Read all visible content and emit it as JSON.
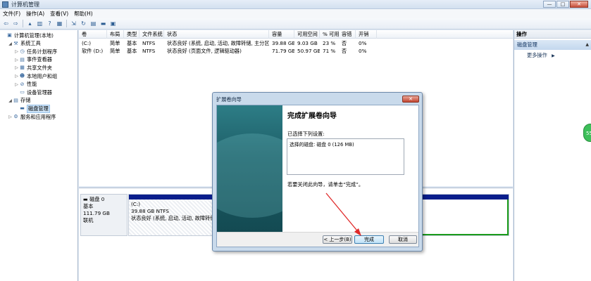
{
  "window": {
    "title": "计算机管理",
    "min": "—",
    "max": "□",
    "close": "✕"
  },
  "menu": [
    "文件(F)",
    "操作(A)",
    "查看(V)",
    "帮助(H)"
  ],
  "toolbar_icons": [
    "back-arrow-icon",
    "forward-arrow-icon",
    "up-folder-icon",
    "show-hide-tree-icon",
    "help-icon",
    "properties-icon",
    "export-icon",
    "refresh-icon",
    "view-icon",
    "disk-icon",
    "help-topics-icon"
  ],
  "tree": [
    {
      "label": "计算机管理(本地)",
      "level": 0,
      "exp": "",
      "icon": "computer-management-icon",
      "glyph": "▣"
    },
    {
      "label": "系统工具",
      "level": 1,
      "exp": "◢",
      "icon": "tools-icon",
      "glyph": "⚒"
    },
    {
      "label": "任务计划程序",
      "level": 2,
      "exp": "▷",
      "icon": "task-scheduler-icon",
      "glyph": "◷"
    },
    {
      "label": "事件查看器",
      "level": 2,
      "exp": "▷",
      "icon": "event-viewer-icon",
      "glyph": "▤"
    },
    {
      "label": "共享文件夹",
      "level": 2,
      "exp": "▷",
      "icon": "shared-folder-icon",
      "glyph": "▦"
    },
    {
      "label": "本地用户和组",
      "level": 2,
      "exp": "▷",
      "icon": "users-icon",
      "glyph": "☻"
    },
    {
      "label": "性能",
      "level": 2,
      "exp": "▷",
      "icon": "performance-icon",
      "glyph": "⊘"
    },
    {
      "label": "设备管理器",
      "level": 2,
      "exp": "",
      "icon": "device-manager-icon",
      "glyph": "▭"
    },
    {
      "label": "存储",
      "level": 1,
      "exp": "◢",
      "icon": "storage-icon",
      "glyph": "▤"
    },
    {
      "label": "磁盘管理",
      "level": 2,
      "exp": "",
      "icon": "disk-management-icon",
      "glyph": "▬"
    },
    {
      "label": "服务和应用程序",
      "level": 1,
      "exp": "▷",
      "icon": "services-icon",
      "glyph": "⚙"
    }
  ],
  "columns": [
    "卷",
    "布局",
    "类型",
    "文件系统",
    "状态",
    "容量",
    "可用空间",
    "% 可用",
    "容错",
    "开销"
  ],
  "volumes": [
    {
      "vol": "(C:)",
      "layout": "简单",
      "type": "基本",
      "fs": "NTFS",
      "status": "状态良好 (系统, 启动, 活动, 故障转储, 主分区)",
      "capacity": "39.88 GB",
      "free": "9.03 GB",
      "pct": "23 %",
      "fault": "否",
      "overhead": "0%"
    },
    {
      "vol": "软件 (D:)",
      "layout": "简单",
      "type": "基本",
      "fs": "NTFS",
      "status": "状态良好 (页面文件, 逻辑驱动器)",
      "capacity": "71.79 GB",
      "free": "50.97 GB",
      "pct": "71 %",
      "fault": "否",
      "overhead": "0%"
    }
  ],
  "disk": {
    "name": "磁盘 0",
    "type": "基本",
    "size": "111.79 GB",
    "state": "联机"
  },
  "partition_c": {
    "name": "(C:)",
    "size": "39.88 GB NTFS",
    "status": "状态良好 (系统, 启动, 活动, 故障转储, 主分区)"
  },
  "actions": {
    "header": "操作",
    "section": "磁盘管理",
    "collapse": "▲",
    "more": "更多操作",
    "more_arrow": "▶"
  },
  "bubble": "55",
  "wizard": {
    "title": "扩展卷向导",
    "close": "✕",
    "heading": "完成扩展卷向导",
    "selected_label": "已选择下列设置:",
    "selected_value": "选择的磁盘: 磁盘 0 (126 MB)",
    "hint": "若要关闭此向导，请单击“完成”。",
    "back": "< 上一步(B)",
    "finish": "完成",
    "cancel": "取消"
  },
  "colors": {
    "accent_bar": "#0a1e8c",
    "extended_border": "#1a9b1a",
    "annotation_arrow": "#e02a2a"
  }
}
